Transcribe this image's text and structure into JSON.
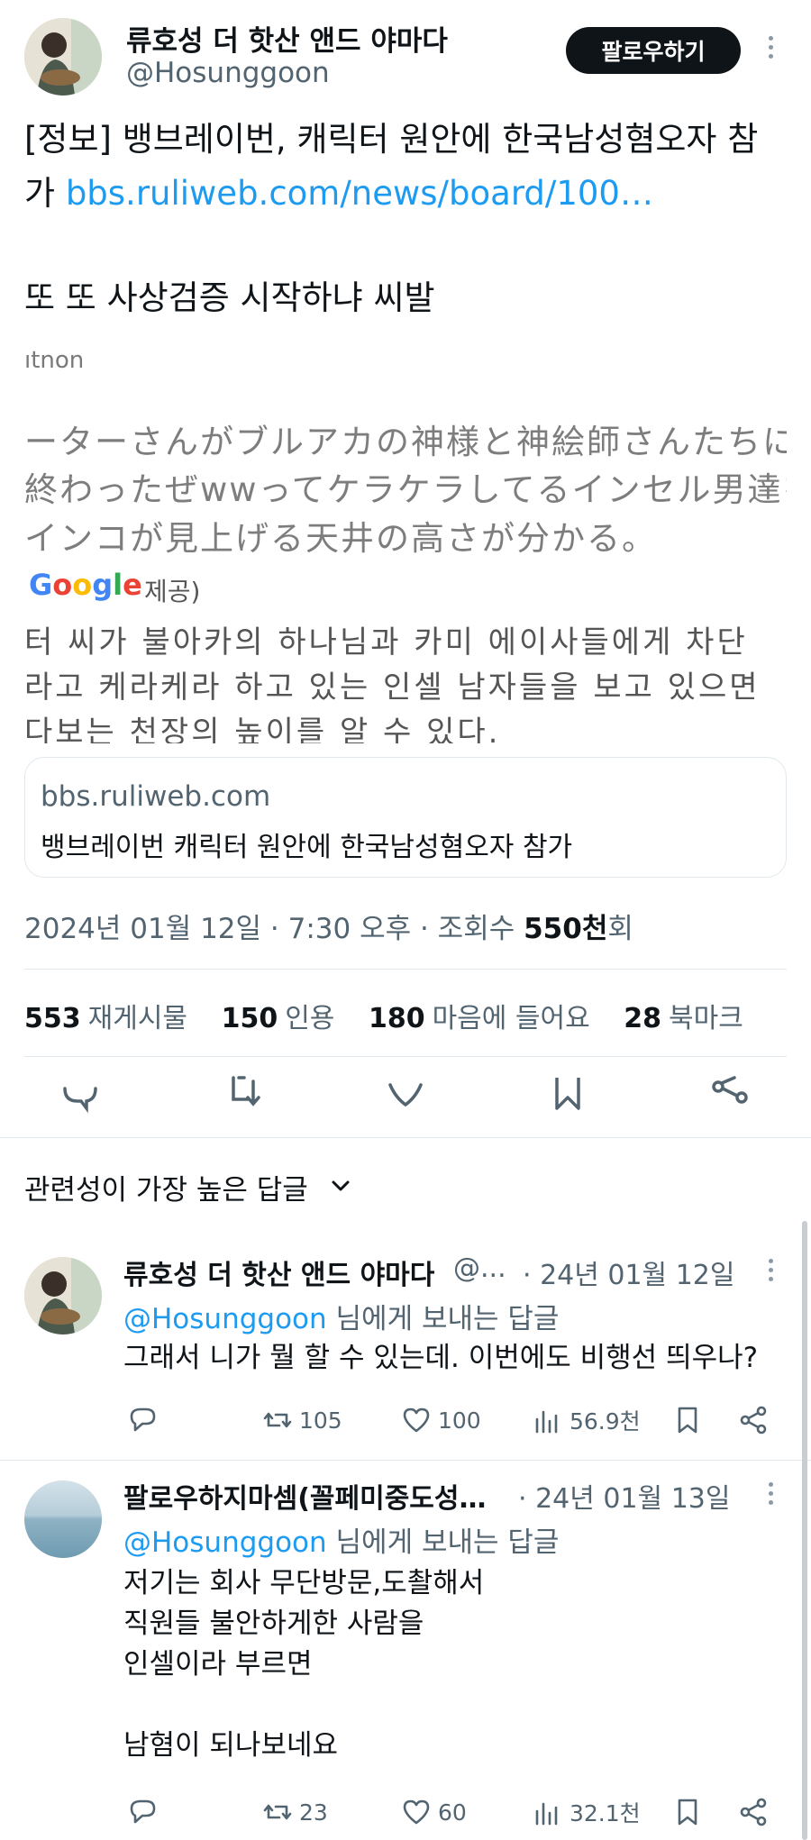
{
  "tweet": {
    "author_name": "류호성 더 핫산 앤드 야마다",
    "author_handle": "@Hosunggoon",
    "follow_label": "팔로우하기",
    "text_prefix": "[정보] 뱅브레이번, 캐릭터 원안에 한국남성혐오자 참가 ",
    "text_link": "bbs.ruliweb.com/news/board/100…",
    "text_line2": "또 또 사상검증 시작하냐 씨발",
    "embed": {
      "fragment": "ıtnon",
      "jp_line1": "ーターさんがブルアカの神様と神絵師さんたちに",
      "jp_line2": "終わったぜwwってケラケラしてるインセル男達を",
      "jp_line3": "インコが見上げる天井の高さが分かる。",
      "google_logo": "Google",
      "google_provided": "제공)",
      "kr_line1": "터 씨가 불아카의 하나님과 카미 에이사들에게 차단",
      "kr_line2": "라고 케라케라 하고 있는 인셀 남자들을 보고 있으면",
      "kr_line3": "다보는 천장의 높이를 알 수 있다."
    },
    "card": {
      "domain": "bbs.ruliweb.com",
      "title": "뱅브레이번 캐릭터 원안에 한국남성혐오자 참가"
    },
    "meta_date": "2024년 01월 12일 · 7:30 오후 · 조회수 ",
    "meta_views": "550천",
    "meta_suffix": "회",
    "stats": [
      {
        "num": "553",
        "label": "재게시물"
      },
      {
        "num": "150",
        "label": "인용"
      },
      {
        "num": "180",
        "label": "마음에 들어요"
      },
      {
        "num": "28",
        "label": "북마크"
      }
    ],
    "actions": [
      "reply-icon",
      "retweet-icon",
      "like-icon",
      "bookmark-icon",
      "share-icon"
    ]
  },
  "sort": {
    "label": "관련성이 가장 높은 답글"
  },
  "replies": [
    {
      "name": "류호성 더 핫산 앤드 야마다",
      "handle": "@...",
      "date": "· 24년 01월 12일",
      "reply_to_handle": "@Hosunggoon",
      "reply_to_suffix": " 님에게 보내는 답글",
      "text": "그래서 니가 뭘 할 수 있는데. 이번에도 비행선 띄우나?",
      "retweets": "105",
      "likes": "100",
      "views": "56.9천"
    },
    {
      "name": "팔로우하지마셈(꼴페미중도성…",
      "handle": "",
      "date": "· 24년 01월 13일",
      "reply_to_handle": "@Hosunggoon",
      "reply_to_suffix": " 님에게 보내는 답글",
      "text": "저기는 회사 무단방문,도촬해서\n직원들 불안하게한 사람을\n인셀이라 부르면\n\n남혐이 되나보네요",
      "retweets": "23",
      "likes": "60",
      "views": "32.1천"
    }
  ],
  "colors": {
    "link": "#1d9bf0",
    "secondary": "#536471",
    "primary": "#0f1419"
  }
}
